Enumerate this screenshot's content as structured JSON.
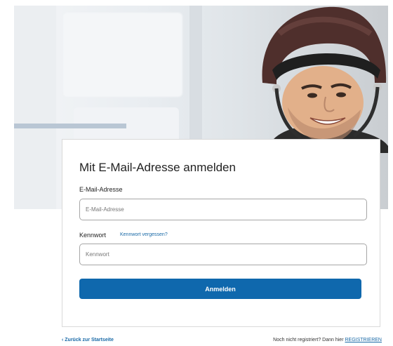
{
  "login": {
    "title": "Mit E-Mail-Adresse anmelden",
    "email_label": "E-Mail-Adresse",
    "email_placeholder": "E-Mail-Adresse",
    "email_value": "",
    "password_label": "Kennwort",
    "forgot_link": "Kennwort vergessen?",
    "password_placeholder": "Kennwort",
    "password_value": "",
    "submit_label": "Anmelden"
  },
  "footer": {
    "back_link": "‹ Zurück zur Startseite",
    "register_text": "Noch nicht registriert? Dann hier ",
    "register_link": "REGISTRIEREN"
  },
  "colors": {
    "primary": "#0f68ad",
    "link": "#1a6aa7",
    "border": "#a6a6a6"
  },
  "hero": {
    "image": "motorcycle-rider-in-helmet-photo"
  }
}
